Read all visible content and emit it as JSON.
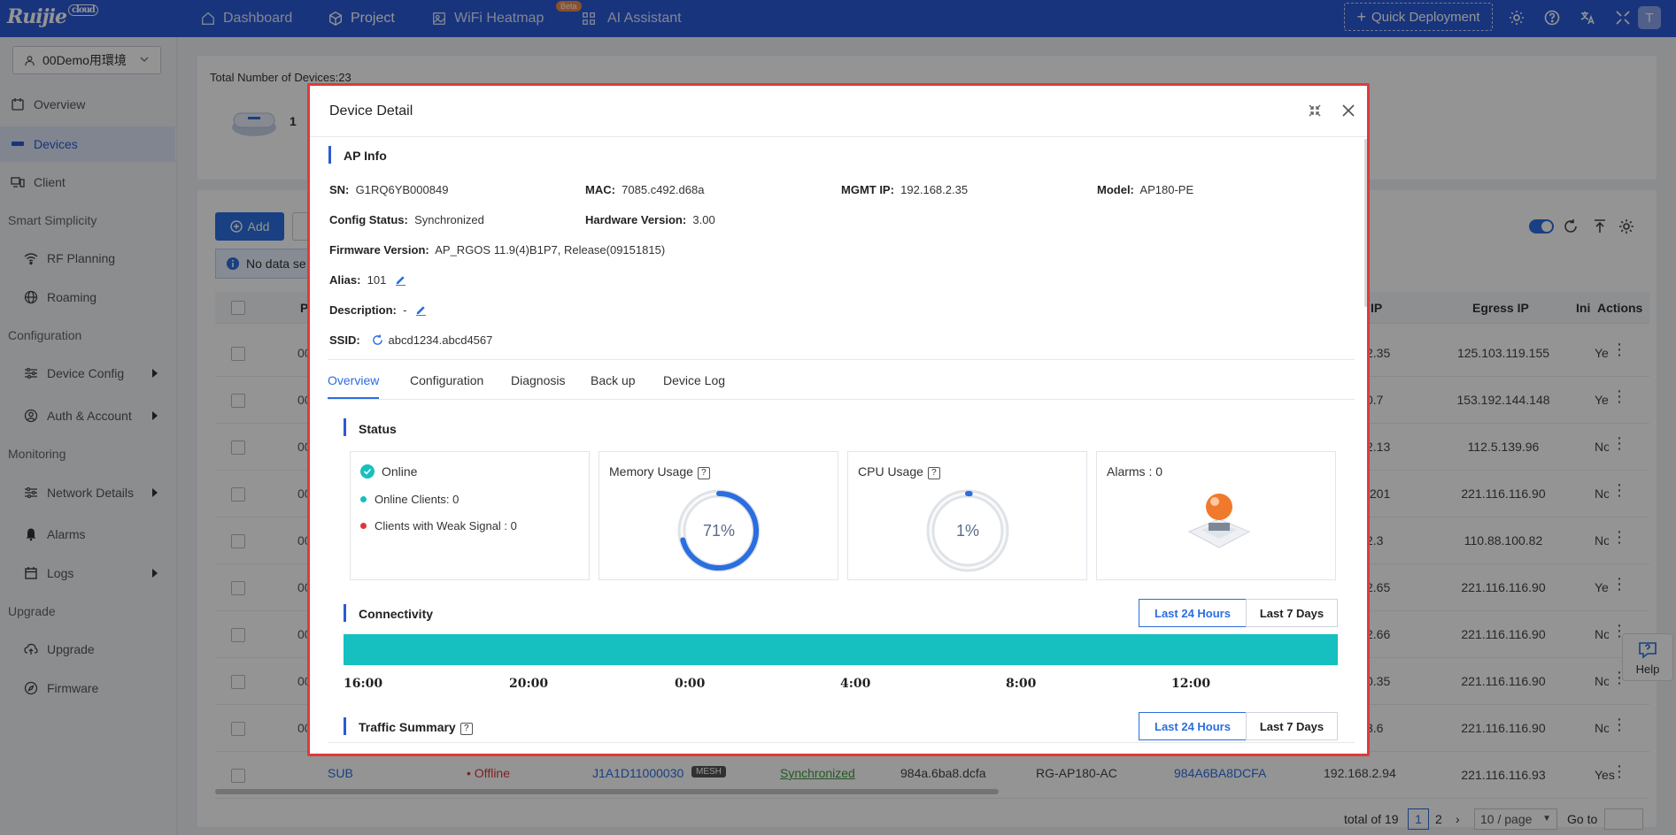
{
  "topbar": {
    "logo": "Ruijie",
    "logo_badge": "cloud",
    "nav": [
      {
        "label": "Dashboard",
        "icon": "home-icon"
      },
      {
        "label": "Project",
        "icon": "cube-icon"
      },
      {
        "label": "WiFi Heatmap",
        "icon": "heatmap-icon",
        "badge": "Beta"
      },
      {
        "label": "AI Assistant",
        "icon": "grid-icon"
      }
    ],
    "quick_deployment": "Quick Deployment",
    "avatar": "T"
  },
  "sidebar": {
    "project": "00Demo用環境",
    "items": [
      {
        "label": "Overview",
        "icon": "overview-icon"
      },
      {
        "label": "Devices",
        "icon": "devices-icon",
        "active": true
      },
      {
        "label": "Client",
        "icon": "client-icon"
      }
    ],
    "sections": [
      {
        "title": "Smart Simplicity",
        "items": [
          "RF Planning",
          "Roaming"
        ]
      },
      {
        "title": "Configuration",
        "items": [
          "Device Config",
          "Auth & Account"
        ]
      },
      {
        "title": "Monitoring",
        "items": [
          "Network Details",
          "Alarms",
          "Logs"
        ]
      },
      {
        "title": "Upgrade",
        "items": [
          "Upgrade",
          "Firmware"
        ]
      }
    ]
  },
  "main": {
    "total_devices": "Total Number of Devices:23",
    "device_count": "1",
    "add_label": "Add",
    "info_text": "No data se",
    "table_headers": {
      "first": "P",
      "ip": "IP",
      "egress": "Egress IP",
      "initial": "Initial",
      "actions": "Actions"
    },
    "rows": [
      {
        "c1": "00",
        "ip": "2.35",
        "egress": "125.103.119.155",
        "initial": "Yes"
      },
      {
        "c1": "00",
        "ip": "0.7",
        "egress": "153.192.144.148",
        "initial": "Yes"
      },
      {
        "c1": "00",
        "ip": "2.13",
        "egress": "112.5.139.96",
        "initial": "No"
      },
      {
        "c1": "00",
        "ip": ".201",
        "egress": "221.116.116.90",
        "initial": "No"
      },
      {
        "c1": "00",
        "ip": "2.3",
        "egress": "110.88.100.82",
        "initial": "No"
      },
      {
        "c1": "00",
        "ip": "2.65",
        "egress": "221.116.116.90",
        "initial": "Yes"
      },
      {
        "c1": "00",
        "ip": "2.66",
        "egress": "221.116.116.90",
        "initial": "No"
      },
      {
        "c1": "00",
        "ip": "0.35",
        "egress": "221.116.116.90",
        "initial": "No"
      },
      {
        "c1": "00",
        "ip": "3.6",
        "egress": "221.116.116.90",
        "initial": "No"
      }
    ],
    "last_row": {
      "name": "SUB",
      "status": "Offline",
      "sn": "J1A1D11000030",
      "tag": "MESH",
      "config": "Synchronized",
      "mac": "984a.6ba8.dcfa",
      "model": "RG-AP180-AC",
      "alias": "984A6BA8DCFA",
      "mgmt_ip": "192.168.2.94",
      "egress": "221.116.116.93",
      "initial": "Yes"
    },
    "pager": {
      "total": "total of 19",
      "page1": "1",
      "page2": "2",
      "per_page": "10 / page",
      "goto": "Go to"
    },
    "help": "Help"
  },
  "modal": {
    "title": "Device Detail",
    "ap_info_title": "AP Info",
    "sn_label": "SN:",
    "sn": "G1RQ6YB000849",
    "mac_label": "MAC:",
    "mac": "7085.c492.d68a",
    "mgmt_label": "MGMT IP:",
    "mgmt": "192.168.2.35",
    "model_label": "Model:",
    "model": "AP180-PE",
    "config_label": "Config Status:",
    "config": "Synchronized",
    "hw_label": "Hardware Version:",
    "hw": "3.00",
    "fw_label": "Firmware Version:",
    "fw": "AP_RGOS 11.9(4)B1P7, Release(09151815)",
    "alias_label": "Alias:",
    "alias": "101",
    "desc_label": "Description:",
    "desc": "-",
    "ssid_label": "SSID:",
    "ssid": "abcd1234.abcd4567",
    "tabs": [
      "Overview",
      "Configuration",
      "Diagnosis",
      "Back up",
      "Device Log"
    ],
    "status_title": "Status",
    "online": "Online",
    "online_clients": "Online Clients: 0",
    "weak_signal": "Clients with Weak Signal : 0",
    "memory_title": "Memory Usage",
    "memory_value": "71%",
    "memory_fraction": 0.71,
    "cpu_title": "CPU Usage",
    "cpu_value": "1%",
    "cpu_fraction": 0.01,
    "alarms": "Alarms : 0",
    "connectivity_title": "Connectivity",
    "last24": "Last 24 Hours",
    "last7": "Last 7 Days",
    "ticks": [
      "16:00",
      "20:00",
      "0:00",
      "4:00",
      "8:00",
      "12:00"
    ],
    "traffic_title": "Traffic Summary",
    "colors": {
      "accent": "#2a6ee0",
      "online": "#16c0c0",
      "border": "#e03a3a",
      "weak": "#e0343a"
    }
  }
}
